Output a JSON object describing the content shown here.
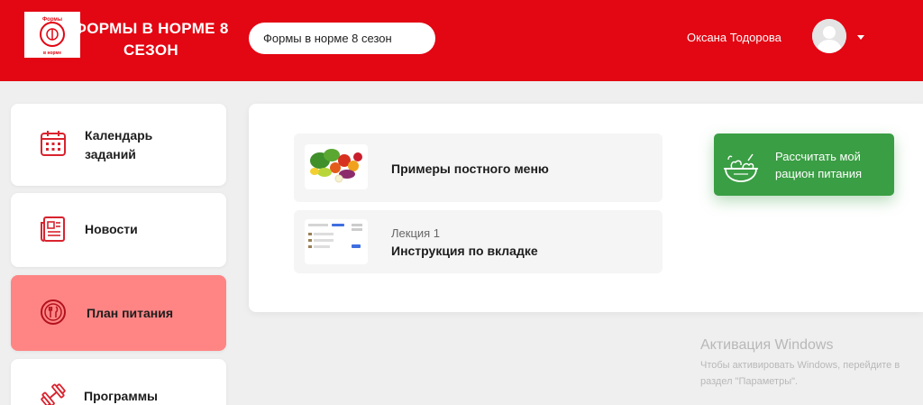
{
  "header": {
    "brand_line1": "ФОРМЫ В НОРМЕ 8",
    "brand_line2": "СЕЗОН",
    "season_select": "Формы в норме 8 сезон",
    "user_name": "Оксана Тодорова",
    "logo_text_top": "Формы",
    "logo_text_bottom": "в норме"
  },
  "sidebar": {
    "items": [
      {
        "label": "Календарь заданий",
        "icon": "calendar-icon"
      },
      {
        "label": "Новости",
        "icon": "newspaper-icon"
      },
      {
        "label": "План питания",
        "icon": "plate-cutlery-icon",
        "active": true
      },
      {
        "label": "Программы",
        "icon": "dumbbell-icon"
      }
    ]
  },
  "main": {
    "items": [
      {
        "title": "Примеры постного меню",
        "thumb": "vegetables-image"
      },
      {
        "subtitle": "Лекция 1",
        "title": "Инструкция по вкладке",
        "thumb": "screenshot-image"
      }
    ],
    "calc_button_line1": "Рассчитать мой",
    "calc_button_line2": "рацион питания"
  },
  "watermark": {
    "title": "Активация Windows",
    "line1": "Чтобы активировать Windows, перейдите в",
    "line2": "раздел \"Параметры\"."
  },
  "colors": {
    "brand_red": "#e30613",
    "active_item": "#ff8585",
    "accent_green": "#3a9e44",
    "background": "#efefef"
  }
}
